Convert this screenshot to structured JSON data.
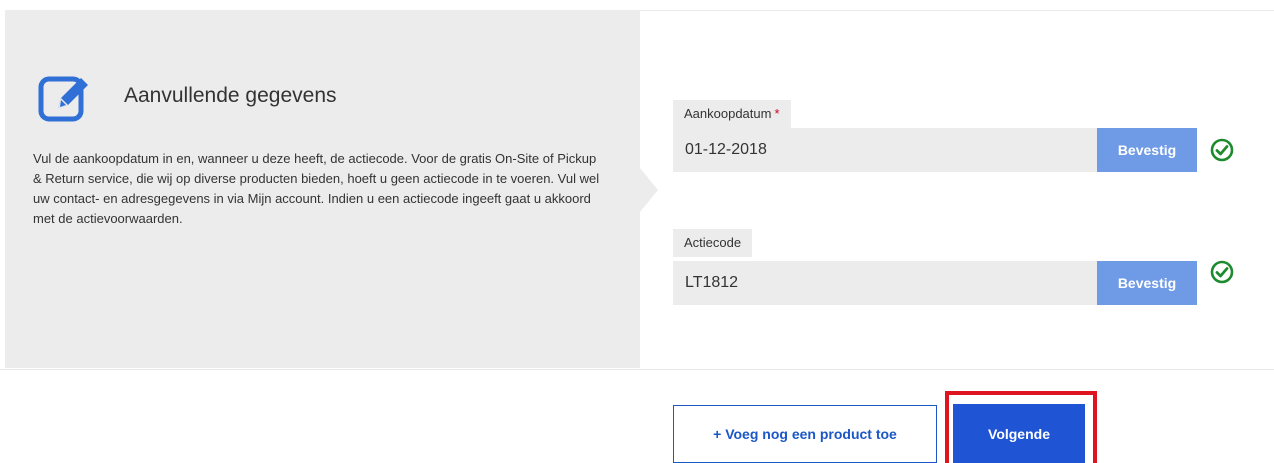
{
  "info": {
    "icon": "edit-icon",
    "title": "Aanvullende gegevens",
    "description": "Vul de aankoopdatum in en, wanneer u deze heeft, de actiecode. Voor de gratis On-Site of Pickup & Return service, die wij op diverse producten bieden, hoeft u geen actiecode in te voeren. Vul wel uw contact- en adresgegevens in via Mijn account. Indien u een actiecode ingeeft gaat u akkoord met de actievoorwaarden."
  },
  "form": {
    "purchase_date": {
      "label": "Aankoopdatum",
      "required_marker": "*",
      "value": "01-12-2018",
      "confirm_label": "Bevestig",
      "status_icon": "check-circle-icon"
    },
    "promo_code": {
      "label": "Actiecode",
      "value": "LT1812",
      "confirm_label": "Bevestig",
      "status_icon": "check-circle-icon"
    }
  },
  "actions": {
    "add_product_label": "+ Voeg nog een product toe",
    "next_label": "Volgende"
  },
  "colors": {
    "accent": "#1f55d4",
    "confirm_button": "#6f9ae6",
    "success": "#1e8a2e",
    "highlight": "#e0141e",
    "panel_bg": "#ececec"
  }
}
